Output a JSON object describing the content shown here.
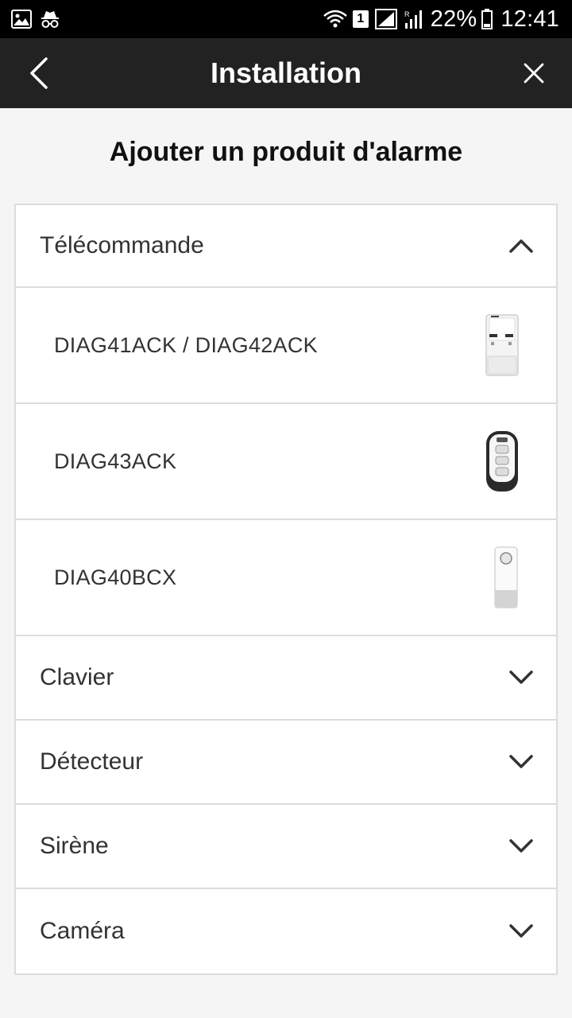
{
  "status_bar": {
    "battery": "22%",
    "time": "12:41",
    "sim_badge": "1"
  },
  "app_bar": {
    "title": "Installation"
  },
  "subtitle": "Ajouter un produit d'alarme",
  "categories": [
    {
      "label": "Télécommande",
      "expanded": true,
      "products": [
        {
          "label": "DIAG41ACK / DIAG42ACK",
          "image": "keyfob-panel-image"
        },
        {
          "label": "DIAG43ACK",
          "image": "keyfob-black-image"
        },
        {
          "label": "DIAG40BCX",
          "image": "keyfob-white-image"
        }
      ]
    },
    {
      "label": "Clavier",
      "expanded": false
    },
    {
      "label": "Détecteur",
      "expanded": false
    },
    {
      "label": "Sirène",
      "expanded": false
    },
    {
      "label": "Caméra",
      "expanded": false
    }
  ],
  "colors": {
    "app_bar": "#222222",
    "status_bar": "#000000",
    "background": "#f5f5f5",
    "divider": "#dcdcdc"
  }
}
